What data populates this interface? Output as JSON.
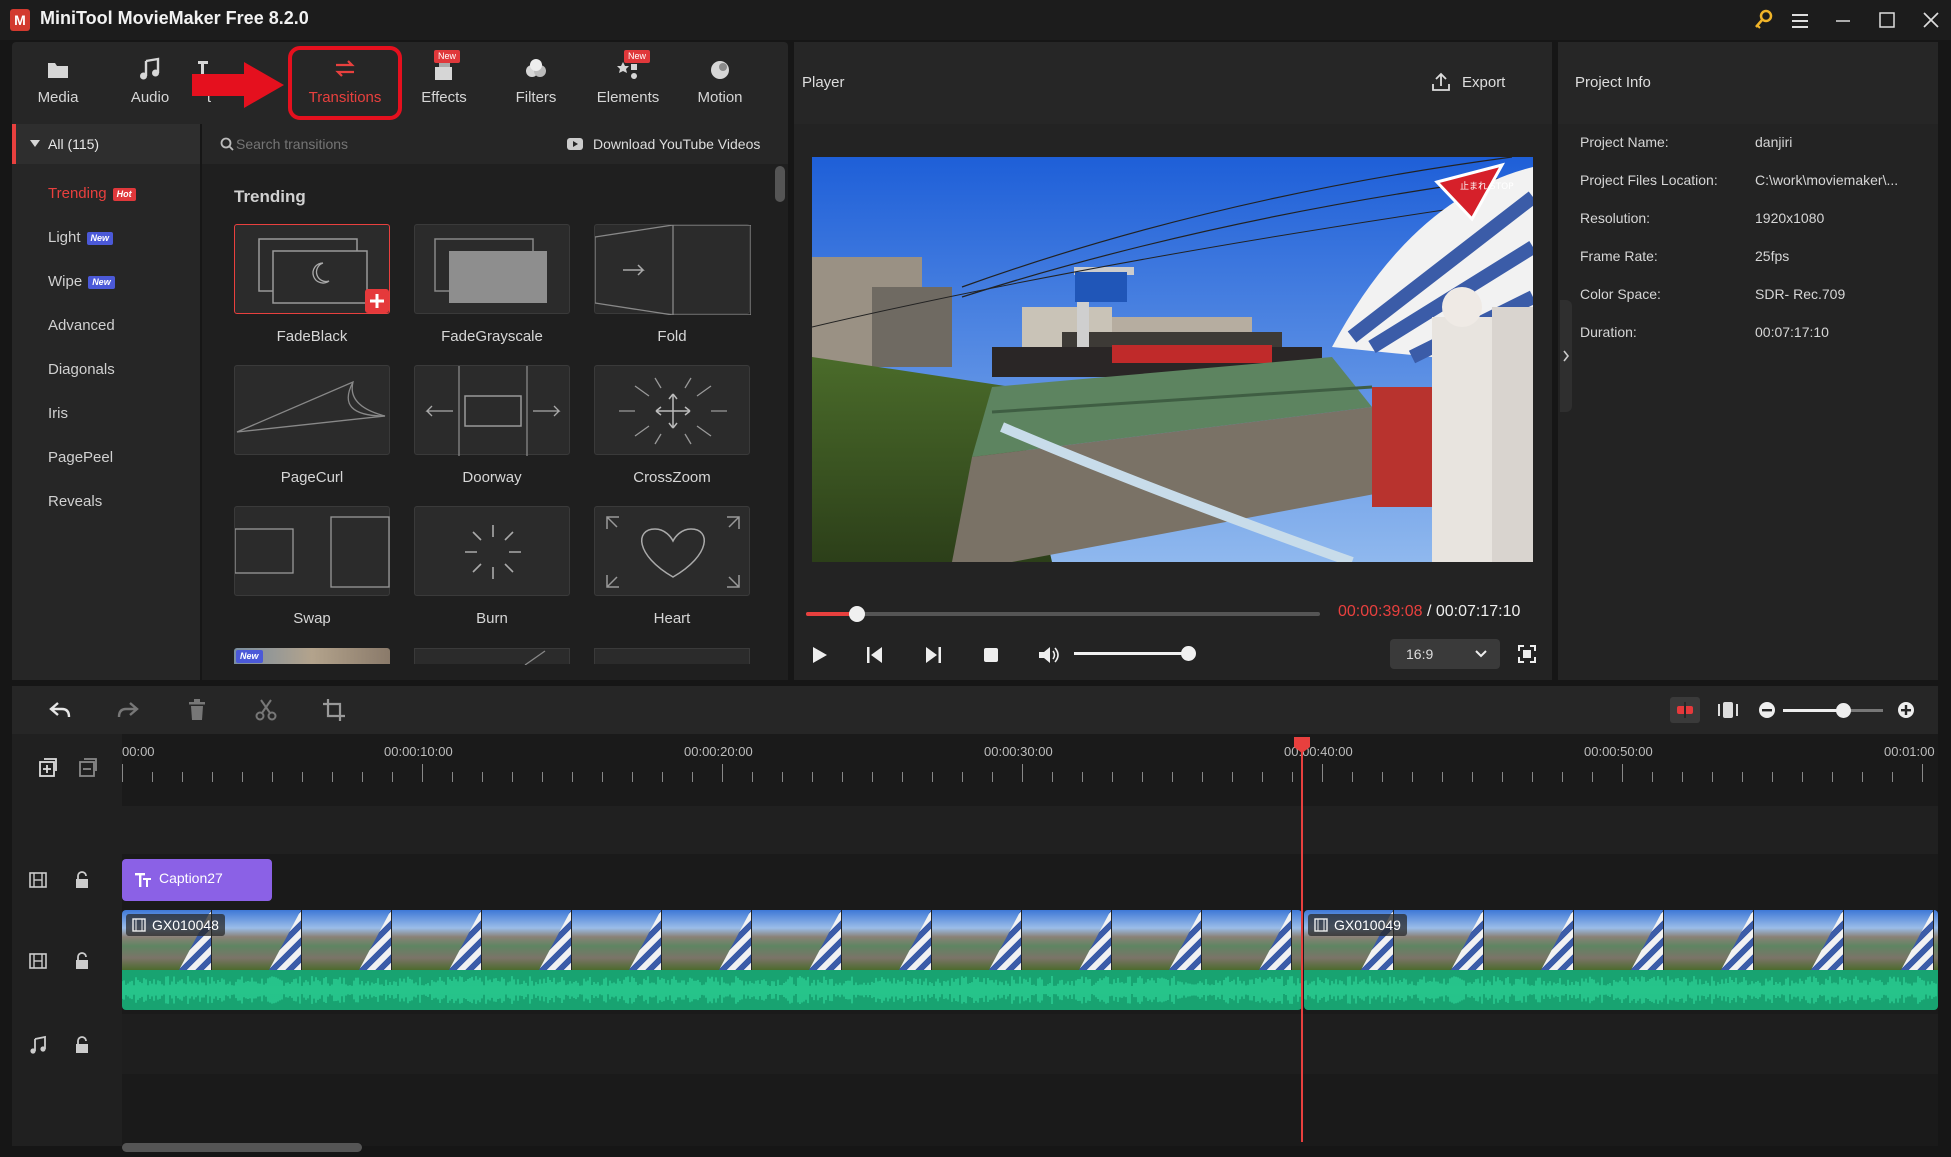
{
  "app": {
    "title": "MiniTool MovieMaker Free 8.2.0",
    "icon_letter": "M"
  },
  "tabs": [
    {
      "label": "Media",
      "icon": "folder-icon"
    },
    {
      "label": "Audio",
      "icon": "music-note-icon"
    },
    {
      "label": "t",
      "icon": "text-icon"
    },
    {
      "label": "Transitions",
      "icon": "swap-arrows-icon",
      "active": true
    },
    {
      "label": "Effects",
      "icon": "effects-icon",
      "badge": "New"
    },
    {
      "label": "Filters",
      "icon": "filters-icon"
    },
    {
      "label": "Elements",
      "icon": "elements-icon",
      "badge": "New"
    },
    {
      "label": "Motion",
      "icon": "motion-icon"
    }
  ],
  "categories": {
    "all": "All (115)",
    "items": [
      {
        "label": "Trending",
        "badge": "Hot",
        "active": true
      },
      {
        "label": "Light",
        "badge": "New"
      },
      {
        "label": "Wipe",
        "badge": "New"
      },
      {
        "label": "Advanced"
      },
      {
        "label": "Diagonals"
      },
      {
        "label": "Iris"
      },
      {
        "label": "PagePeel"
      },
      {
        "label": "Reveals"
      }
    ]
  },
  "transitions": {
    "search_placeholder": "Search transitions",
    "download_label": "Download YouTube Videos",
    "section_title": "Trending",
    "items": [
      "FadeBlack",
      "FadeGrayscale",
      "Fold",
      "PageCurl",
      "Doorway",
      "CrossZoom",
      "Swap",
      "Burn",
      "Heart"
    ],
    "partial_badge": "New"
  },
  "player": {
    "title": "Player",
    "export_label": "Export",
    "current_time": "00:00:39:08",
    "separator": " / ",
    "total_time": "00:07:17:10",
    "progress_fraction": 0.1,
    "volume_fraction": 0.97,
    "aspect_ratio": "16:9",
    "sign_text": "止まれ STOP"
  },
  "project_info": {
    "title": "Project Info",
    "rows": [
      {
        "key": "Project Name:",
        "value": "danjiri"
      },
      {
        "key": "Project Files Location:",
        "value": "C:\\work\\moviemaker\\..."
      },
      {
        "key": "Resolution:",
        "value": "1920x1080"
      },
      {
        "key": "Frame Rate:",
        "value": "25fps"
      },
      {
        "key": "Color Space:",
        "value": "SDR- Rec.709"
      },
      {
        "key": "Duration:",
        "value": "00:07:17:10"
      }
    ]
  },
  "timeline": {
    "ticks": [
      "00:00",
      "00:00:10:00",
      "00:00:20:00",
      "00:00:30:00",
      "00:00:40:00",
      "00:00:50:00",
      "00:01:00"
    ],
    "caption_clip": "Caption27",
    "video_clips": [
      "GX010048",
      "GX010049"
    ],
    "zoom_fraction": 0.6
  },
  "colors": {
    "accent_red": "#e8403e",
    "caption_purple": "#8b61e6",
    "audio_green": "#1fbf8a",
    "highlight_red": "#e5101e"
  }
}
